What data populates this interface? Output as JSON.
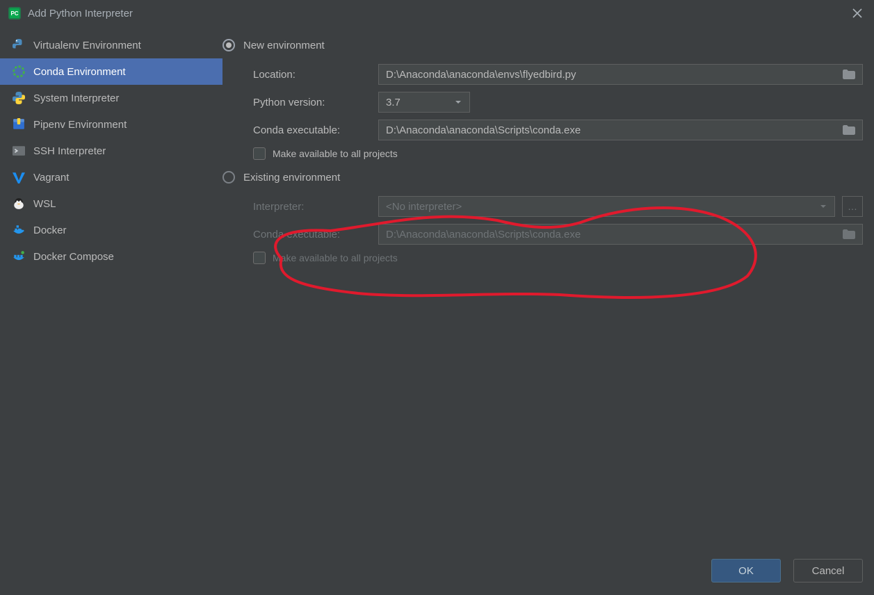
{
  "title": "Add Python Interpreter",
  "sidebar": {
    "items": [
      {
        "label": "Virtualenv Environment",
        "icon": "python-icon",
        "color": "#4b8bbe"
      },
      {
        "label": "Conda Environment",
        "icon": "conda-icon",
        "color": "#43b049",
        "selected": true
      },
      {
        "label": "System Interpreter",
        "icon": "python-icon",
        "color": "#4b8bbe"
      },
      {
        "label": "Pipenv Environment",
        "icon": "package-icon",
        "color": "#2f6fd0"
      },
      {
        "label": "SSH Interpreter",
        "icon": "ssh-icon",
        "color": "#7e858a"
      },
      {
        "label": "Vagrant",
        "icon": "vagrant-icon",
        "color": "#1c8ef0"
      },
      {
        "label": "WSL",
        "icon": "linux-icon",
        "color": "#e8e8e8"
      },
      {
        "label": "Docker",
        "icon": "docker-icon",
        "color": "#2496ed"
      },
      {
        "label": "Docker Compose",
        "icon": "docker-compose-icon",
        "color": "#2496ed"
      }
    ]
  },
  "form": {
    "new_env": {
      "radio_label": "New environment",
      "location_label": "Location:",
      "location_value": "D:\\Anaconda\\anaconda\\envs\\flyedbird.py",
      "python_version_label": "Python version:",
      "python_version_value": "3.7",
      "conda_exec_label": "Conda executable:",
      "conda_exec_value": "D:\\Anaconda\\anaconda\\Scripts\\conda.exe",
      "make_available_label": "Make available to all projects"
    },
    "existing_env": {
      "radio_label": "Existing environment",
      "interpreter_label": "Interpreter:",
      "interpreter_value": "<No interpreter>",
      "conda_exec_label": "Conda executable:",
      "conda_exec_value": "D:\\Anaconda\\anaconda\\Scripts\\conda.exe",
      "make_available_label": "Make available to all projects"
    }
  },
  "buttons": {
    "ok": "OK",
    "cancel": "Cancel"
  },
  "annotation": {
    "color": "#e01a2d"
  }
}
